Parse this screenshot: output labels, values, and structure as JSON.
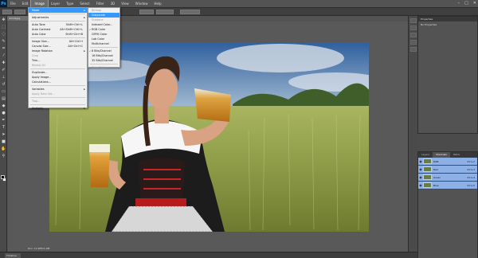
{
  "app": {
    "logo": "Ps"
  },
  "menubar": [
    "File",
    "Edit",
    "Image",
    "Layer",
    "Type",
    "Select",
    "Filter",
    "3D",
    "View",
    "Window",
    "Help"
  ],
  "window_controls": [
    "–",
    "□",
    "✕"
  ],
  "doc_tab": "dirndl.jpg",
  "image_menu": [
    {
      "label": "Mode",
      "shortcut": "",
      "submenu": true,
      "state": "highlight"
    },
    {
      "sep": true
    },
    {
      "label": "Adjustments",
      "shortcut": "",
      "submenu": true
    },
    {
      "sep": true
    },
    {
      "label": "Auto Tone",
      "shortcut": "Shift+Ctrl+L"
    },
    {
      "label": "Auto Contrast",
      "shortcut": "Alt+Shift+Ctrl+L"
    },
    {
      "label": "Auto Color",
      "shortcut": "Shift+Ctrl+B"
    },
    {
      "sep": true
    },
    {
      "label": "Image Size...",
      "shortcut": "Alt+Ctrl+I"
    },
    {
      "label": "Canvas Size...",
      "shortcut": "Alt+Ctrl+C"
    },
    {
      "label": "Image Rotation",
      "shortcut": "",
      "submenu": true
    },
    {
      "label": "Crop",
      "shortcut": "",
      "state": "disabled"
    },
    {
      "label": "Trim...",
      "shortcut": ""
    },
    {
      "label": "Reveal All",
      "shortcut": "",
      "state": "disabled"
    },
    {
      "sep": true
    },
    {
      "label": "Duplicate...",
      "shortcut": ""
    },
    {
      "label": "Apply Image...",
      "shortcut": ""
    },
    {
      "label": "Calculations...",
      "shortcut": ""
    },
    {
      "sep": true
    },
    {
      "label": "Variables",
      "shortcut": "",
      "submenu": true
    },
    {
      "label": "Apply Data Set...",
      "shortcut": "",
      "state": "disabled"
    },
    {
      "sep": true
    },
    {
      "label": "Trap...",
      "shortcut": "",
      "state": "disabled"
    },
    {
      "sep": true
    },
    {
      "label": "Analysis",
      "shortcut": "",
      "submenu": true
    }
  ],
  "mode_menu": [
    {
      "label": "Bitmap",
      "state": "disabled"
    },
    {
      "label": "Grayscale",
      "state": "highlight"
    },
    {
      "label": "Duotone",
      "state": "disabled"
    },
    {
      "label": "Indexed Color..."
    },
    {
      "label": "RGB Color",
      "checked": true
    },
    {
      "label": "CMYK Color"
    },
    {
      "label": "Lab Color"
    },
    {
      "label": "Multichannel"
    },
    {
      "sep": true
    },
    {
      "label": "8 Bits/Channel",
      "checked": true
    },
    {
      "label": "16 Bits/Channel"
    },
    {
      "label": "32 Bits/Channel"
    },
    {
      "sep": true
    },
    {
      "label": "Color Table...",
      "state": "disabled"
    }
  ],
  "status": "Doc: 11.9M/11.9M",
  "timeline_tab": "Timeline",
  "properties": {
    "title": "Properties",
    "subtitle": "No Properties"
  },
  "channels_panel": {
    "tabs": [
      "Layers",
      "Channels",
      "Paths"
    ],
    "rows": [
      {
        "name": "RGB",
        "key": "Ctrl+2"
      },
      {
        "name": "Red",
        "key": "Ctrl+3"
      },
      {
        "name": "Green",
        "key": "Ctrl+4"
      },
      {
        "name": "Blue",
        "key": "Ctrl+5"
      }
    ]
  },
  "tools": [
    "move-icon",
    "marquee-icon",
    "lasso-icon",
    "quick-select-icon",
    "crop-icon",
    "eyedropper-icon",
    "healing-icon",
    "brush-icon",
    "stamp-icon",
    "history-brush-icon",
    "eraser-icon",
    "gradient-icon",
    "blur-icon",
    "dodge-icon",
    "pen-icon",
    "type-icon",
    "path-select-icon",
    "shape-icon",
    "hand-icon",
    "zoom-icon"
  ],
  "colors": {
    "highlight": "#3399ff",
    "panel": "#535353",
    "menu_bg": "#f0f0f0"
  }
}
